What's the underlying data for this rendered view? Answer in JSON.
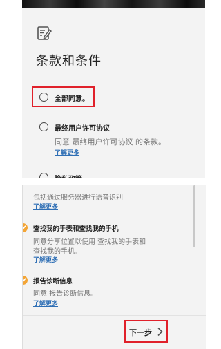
{
  "header": {
    "edit_icon": "edit-document-icon",
    "title": "条款和条件"
  },
  "consent": {
    "agree_all": {
      "label": "全部同意。",
      "checked": false
    },
    "eula": {
      "label": "最终用户许可协议",
      "description": "同意 最终用户许可协议 的条款。",
      "learn_more": "了解更多",
      "checked": false
    },
    "privacy": {
      "label": "隐私政策",
      "checked": false
    }
  },
  "continued": {
    "voice_desc_tail": "包括通过服务器进行语音识别",
    "voice_learn_more": "了解更多",
    "find_my_watch": {
      "label": "查找我的手表和查找我的手机",
      "description_line1": "同意分享位置以使用 查找我的手表和",
      "description_line2": "查找我的手机。",
      "learn_more": "了解更多",
      "checked": true
    },
    "diagnostics": {
      "label": "报告诊断信息",
      "description": "同意 报告诊断信息。",
      "learn_more": "了解更多",
      "checked": true
    }
  },
  "footer": {
    "next_label": "下一步",
    "next_icon": "chevron-right-icon"
  },
  "colors": {
    "highlight": "#e0202a",
    "checked_accent": "#f3a536",
    "link": "#2f6fb5"
  }
}
